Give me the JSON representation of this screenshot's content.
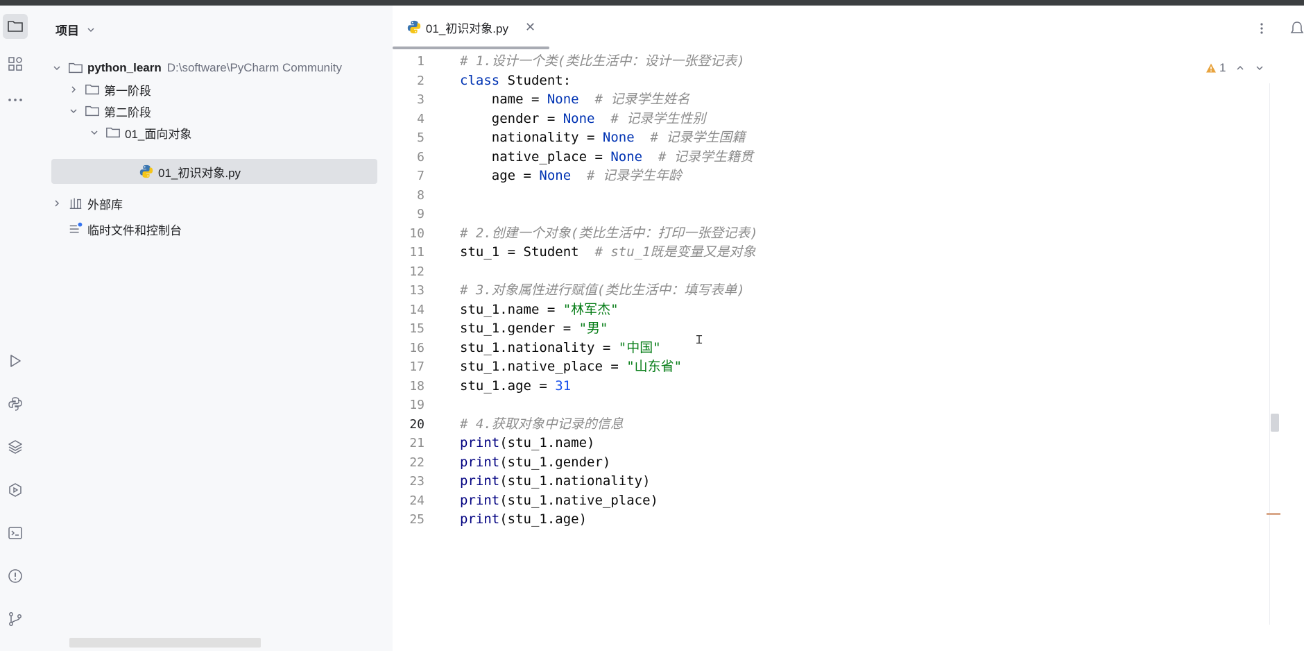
{
  "project": {
    "title": "项目",
    "root_name": "python_learn",
    "root_path": "D:\\software\\PyCharm Community",
    "tree": [
      {
        "label": "第一阶段"
      },
      {
        "label": "第二阶段"
      },
      {
        "label": "01_面向对象"
      },
      {
        "label": "01_初识对象.py"
      },
      {
        "label": "外部库"
      },
      {
        "label": "临时文件和控制台"
      }
    ]
  },
  "editor": {
    "tab_label": "01_初识对象.py",
    "warning_count": "1",
    "current_line": 20,
    "line_numbers": [
      "1",
      "2",
      "3",
      "4",
      "5",
      "6",
      "7",
      "8",
      "9",
      "10",
      "11",
      "12",
      "13",
      "14",
      "15",
      "16",
      "17",
      "18",
      "19",
      "20",
      "21",
      "22",
      "23",
      "24",
      "25"
    ],
    "lines": {
      "l1_cm": "# 1.设计一个类(类比生活中：设计一张登记表)",
      "l2_kw": "class",
      "l2_rest": " Student:",
      "l3_pre": "    name = ",
      "l3_none": "None",
      "l3_cm": "  # 记录学生姓名",
      "l4_pre": "    gender = ",
      "l4_none": "None",
      "l4_cm": "  # 记录学生性别",
      "l5_pre": "    nationality = ",
      "l5_none": "None",
      "l5_cm": "  # 记录学生国籍",
      "l6_pre": "    native_place = ",
      "l6_none": "None",
      "l6_cm": "  # 记录学生籍贯",
      "l7_pre": "    age = ",
      "l7_none": "None",
      "l7_cm": "  # 记录学生年龄",
      "l10_cm": "# 2.创建一个对象(类比生活中：打印一张登记表)",
      "l11_pre": "stu_1 = Student",
      "l11_cm": "  # stu_1既是变量又是对象",
      "l13_cm": "# 3.对象属性进行赋值(类比生活中：填写表单)",
      "l14_pre": "stu_1.name = ",
      "l14_str": "\"林军杰\"",
      "l15_pre": "stu_1.gender = ",
      "l15_str": "\"男\"",
      "l16_pre": "stu_1.nationality = ",
      "l16_str": "\"中国\"",
      "l17_pre": "stu_1.native_place = ",
      "l17_str": "\"山东省\"",
      "l18_pre": "stu_1.age = ",
      "l18_num": "31",
      "l20_cm": "# 4.获取对象中记录的信息",
      "print_kw": "print",
      "l21_rest": "(stu_1.name)",
      "l22_rest": "(stu_1.gender)",
      "l23_rest": "(stu_1.nationality)",
      "l24_rest": "(stu_1.native_place)",
      "l25_rest": "(stu_1.age)"
    }
  },
  "colors": {
    "keyword": "#0033b3",
    "comment": "#8c8c8c",
    "string": "#067d17",
    "number": "#1750eb",
    "builtin": "#000080",
    "warning": "#e8a33d"
  },
  "icons": {
    "toolstrip": [
      "folder-icon",
      "structure-icon",
      "more-horizontal-icon",
      "run-icon",
      "python-console-icon",
      "layers-icon",
      "services-icon",
      "terminal-icon",
      "problems-icon",
      "git-icon"
    ]
  }
}
